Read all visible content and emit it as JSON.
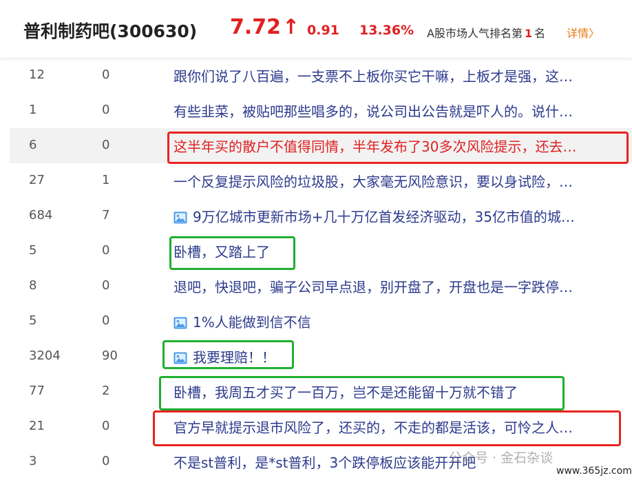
{
  "header": {
    "title": "普利制药吧(300630)",
    "price": "7.72",
    "arrow": "↑",
    "change": "0.91",
    "change_pct": "13.36%",
    "rank_prefix": "A股市场人气排名第",
    "rank_num": "1",
    "rank_suffix": "名",
    "detail_label": "详情〉"
  },
  "rows": [
    {
      "reads": "12",
      "replies": "0",
      "title": "跟你们说了八百遍，一支票不上板你买它干嘛，上板才是强，这…"
    },
    {
      "reads": "1",
      "replies": "0",
      "title": "有些韭菜，被贴吧那些唱多的，说公司出公告就是吓人的。说什…"
    },
    {
      "reads": "6",
      "replies": "0",
      "title": "这半年买的散户不值得同情，半年发布了30多次风险提示，还去…"
    },
    {
      "reads": "27",
      "replies": "1",
      "title": "一个反复提示风险的垃圾股，大家毫无风险意识，要以身试险，…"
    },
    {
      "reads": "684",
      "replies": "7",
      "title": "9万亿城市更新市场+几十万亿首发经济驱动，35亿市值的城…"
    },
    {
      "reads": "5",
      "replies": "0",
      "title": "卧槽，又踏上了"
    },
    {
      "reads": "8",
      "replies": "0",
      "title": "退吧，快退吧，骗子公司早点退，别开盘了，开盘也是一字跌停…"
    },
    {
      "reads": "5",
      "replies": "0",
      "title": "1%人能做到信不信"
    },
    {
      "reads": "3204",
      "replies": "90",
      "title": "我要理赔！！"
    },
    {
      "reads": "77",
      "replies": "2",
      "title": "卧槽，我周五才买了一百万，岂不是还能留十万就不错了"
    },
    {
      "reads": "21",
      "replies": "0",
      "title": "官方早就提示退市风险了，还买的，不走的都是活该，可怜之人…"
    },
    {
      "reads": "3",
      "replies": "0",
      "title": "不是st普利，是*st普利，3个跌停板应该能开开吧"
    }
  ],
  "watermark": {
    "text": "公众号 · 金石杂谈",
    "url": "www.365jz.com"
  },
  "colors": {
    "price_red": "#e02020",
    "link_blue": "#2c3a8c",
    "detail_orange": "#e47a14",
    "box_red": "#e8231f",
    "box_green": "#1fae2f"
  }
}
